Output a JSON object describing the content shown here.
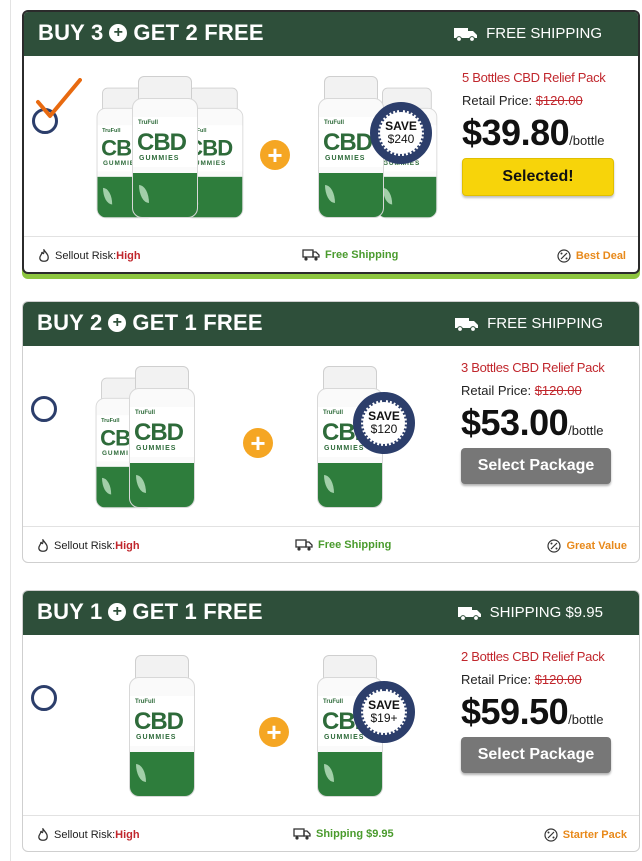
{
  "packages": [
    {
      "deal_left": "BUY 3",
      "deal_right": "GET 2 FREE",
      "shipping_header": "FREE SHIPPING",
      "pack_name": "5 Bottles CBD Relief Pack",
      "retail_label": "Retail Price:",
      "retail_price": "$120.00",
      "price": "$39.80",
      "per": "/bottle",
      "button": "Selected!",
      "save_line1": "SAVE",
      "save_line2": "$240",
      "risk_label": "Sellout Risk:",
      "risk_value": "High",
      "shipping_footer": "Free Shipping",
      "tag": "Best Deal",
      "selected": true
    },
    {
      "deal_left": "BUY 2",
      "deal_right": "GET 1 FREE",
      "shipping_header": "FREE SHIPPING",
      "pack_name": "3 Bottles CBD Relief Pack",
      "retail_label": "Retail Price:",
      "retail_price": "$120.00",
      "price": "$53.00",
      "per": "/bottle",
      "button": "Select Package",
      "save_line1": "SAVE",
      "save_line2": "$120",
      "risk_label": "Sellout Risk:",
      "risk_value": "High",
      "shipping_footer": "Free Shipping",
      "tag": "Great Value",
      "selected": false
    },
    {
      "deal_left": "BUY 1",
      "deal_right": "GET 1 FREE",
      "shipping_header": "SHIPPING $9.95",
      "pack_name": "2 Bottles CBD Relief Pack",
      "retail_label": "Retail Price:",
      "retail_price": "$120.00",
      "price": "$59.50",
      "per": "/bottle",
      "button": "Select Package",
      "save_line1": "SAVE",
      "save_line2": "$19+",
      "risk_label": "Sellout Risk:",
      "risk_value": "High",
      "shipping_footer": "Shipping $9.95",
      "tag": "Starter Pack",
      "selected": false
    }
  ],
  "bottle_label": {
    "brand": "TruFull",
    "cbd": "CBD",
    "gummies": "GUMMIES"
  },
  "colors": {
    "header_green": "#2e4f3a",
    "risk_red": "#c1272d",
    "shipping_green": "#4a9b2d",
    "tag_orange": "#e8891a",
    "selected_yellow": "#f7d40a"
  },
  "icons": {
    "deal_plus": "plus-circle-icon",
    "truck": "truck-icon",
    "flame": "flame-icon",
    "badge": "percent-badge-icon",
    "check": "checkmark-icon"
  }
}
